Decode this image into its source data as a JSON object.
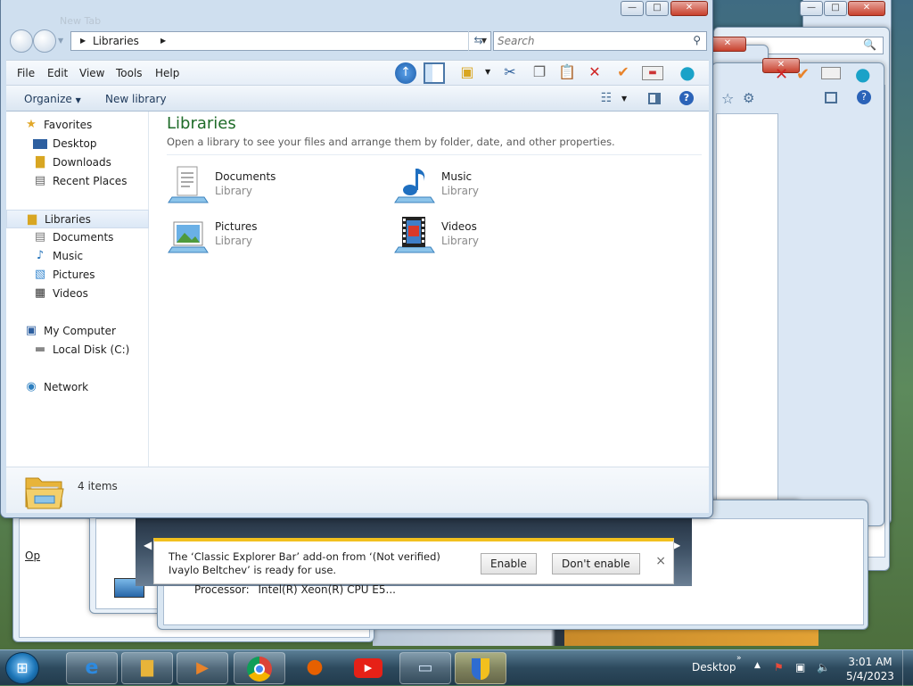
{
  "window": {
    "ghost_tab": "New Tab",
    "controls": {
      "minimize": "—",
      "maximize": "□",
      "close": "✕"
    }
  },
  "address": {
    "breadcrumb": "Libraries",
    "search_placeholder": "Search"
  },
  "menubar": {
    "items": [
      "File",
      "Edit",
      "View",
      "Tools",
      "Help"
    ]
  },
  "toolbar_icons": [
    "up-icon",
    "panes-icon",
    "folder-options-icon",
    "cut-icon",
    "copy-icon",
    "paste-icon",
    "delete-icon",
    "properties-icon",
    "email-icon",
    "shell-icon"
  ],
  "commandbar": {
    "organize": "Organize",
    "new_library": "New library"
  },
  "navpane": {
    "favorites": "Favorites",
    "desktop": "Desktop",
    "downloads": "Downloads",
    "recent_places": "Recent Places",
    "libraries": "Libraries",
    "documents": "Documents",
    "music": "Music",
    "pictures": "Pictures",
    "videos": "Videos",
    "my_computer": "My Computer",
    "local_disk": "Local Disk (C:)",
    "network": "Network"
  },
  "content": {
    "title": "Libraries",
    "subtitle": "Open a library to see your files and arrange them by folder, date, and other properties.",
    "libraries": [
      {
        "name": "Documents",
        "type": "Library"
      },
      {
        "name": "Music",
        "type": "Library"
      },
      {
        "name": "Pictures",
        "type": "Library"
      },
      {
        "name": "Videos",
        "type": "Library"
      }
    ]
  },
  "statusbar": {
    "count": "4 items"
  },
  "notification": {
    "message": "The ‘Classic Explorer Bar’ add-on from ‘(Not verified) Ivaylo Beltchev’ is ready for use.",
    "enable": "Enable",
    "dont_enable": "Don't enable",
    "close": "×"
  },
  "background": {
    "processor_label": "Processor:",
    "processor_value": "Intel(R) Xeon(R) CPU E5...",
    "partial_label": "Op"
  },
  "taskbar": {
    "desktop_label": "Desktop",
    "time": "3:01 AM",
    "date": "5/4/2023"
  },
  "colors": {
    "accent_title": "#1e6b28",
    "notification_bar": "#f2c01e",
    "taskbar": "#2d4a5e"
  }
}
